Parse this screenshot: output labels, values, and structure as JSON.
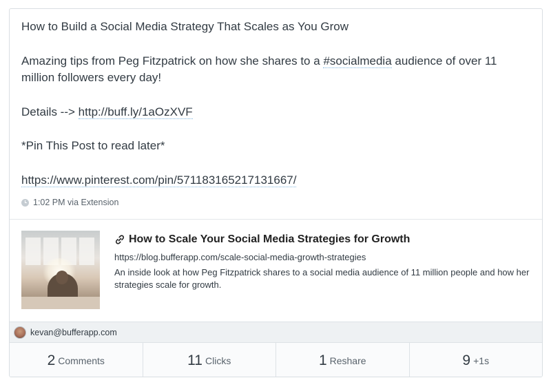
{
  "post": {
    "lines": [
      "How to Build a Social Media Strategy That Scales as You Grow",
      "Amazing tips from Peg Fitzpatrick on how she shares to a",
      "#socialmedia",
      "audience of over 11 million followers every day!",
      "Details -->",
      "http://buff.ly/1aOzXVF",
      "*Pin This Post to read later*",
      "https://www.pinterest.com/pin/571183165217131667/"
    ],
    "time": "1:02 PM",
    "via": "via Extension"
  },
  "preview": {
    "title": "How to Scale Your Social Media Strategies for Growth",
    "url": "https://blog.bufferapp.com/scale-social-media-growth-strategies",
    "description": "An inside look at how Peg Fitzpatrick shares to a social media audience of 11 million people and how her strategies scale for growth."
  },
  "user": {
    "email": "kevan@bufferapp.com"
  },
  "stats": [
    {
      "value": "2",
      "label": "Comments"
    },
    {
      "value": "11",
      "label": "Clicks"
    },
    {
      "value": "1",
      "label": "Reshare"
    },
    {
      "value": "9",
      "label": "+1s"
    }
  ],
  "colors": {
    "text": "#323b43",
    "link_underline": "#7fb6e0",
    "user_bar": "#eef1f3"
  },
  "icons": {
    "clock": "clock-icon",
    "link": "link-icon",
    "avatar": "avatar"
  }
}
